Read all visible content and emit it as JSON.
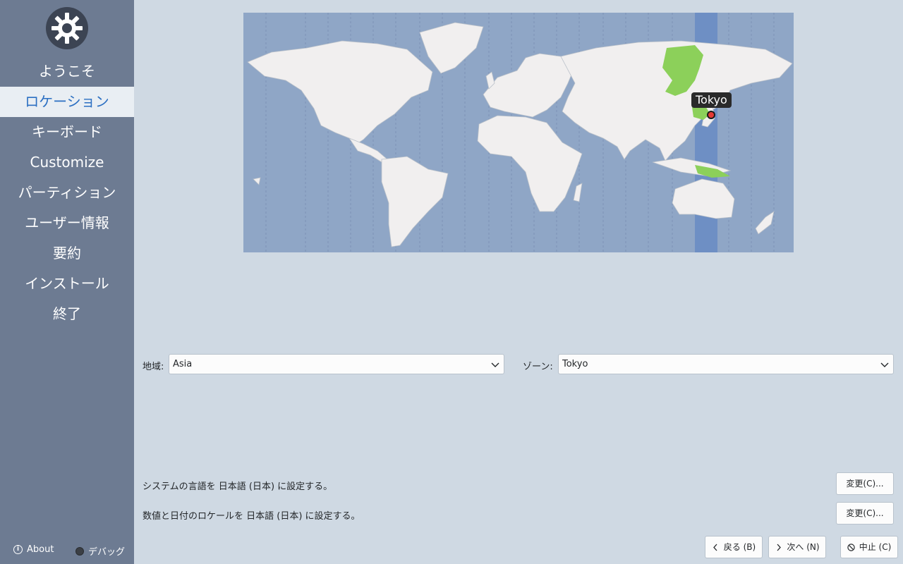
{
  "sidebar": {
    "items": [
      {
        "label": "ようこそ",
        "active": false
      },
      {
        "label": "ロケーション",
        "active": true
      },
      {
        "label": "キーボード",
        "active": false
      },
      {
        "label": "Customize",
        "active": false
      },
      {
        "label": "パーティション",
        "active": false
      },
      {
        "label": "ユーザー情報",
        "active": false
      },
      {
        "label": "要約",
        "active": false
      },
      {
        "label": "インストール",
        "active": false
      },
      {
        "label": "終了",
        "active": false
      }
    ],
    "about_label": "About",
    "debug_label": "デバッグ"
  },
  "map": {
    "selected_city": "Tokyo"
  },
  "location": {
    "region_label": "地域:",
    "region_value": "Asia",
    "zone_label": "ゾーン:",
    "zone_value": "Tokyo"
  },
  "locale": {
    "language_text": "システムの言語を 日本語 (日本) に設定する。",
    "language_button": "変更(C)...",
    "numbers_text": "数値と日付のロケールを 日本語 (日本) に設定する。",
    "numbers_button": "変更(C)..."
  },
  "footer": {
    "back_label": "戻る (B)",
    "next_label": "次へ (N)",
    "cancel_label": "中止 (C)"
  },
  "colors": {
    "sidebar_bg": "#6d7b92",
    "active_item_bg": "#e9eef3",
    "active_item_text": "#2b6fc2",
    "ocean": "#8fa6c6",
    "land": "#f1efef",
    "timezone_band": "#6e8fc4",
    "timezone_highlight": "#8cd05a"
  }
}
